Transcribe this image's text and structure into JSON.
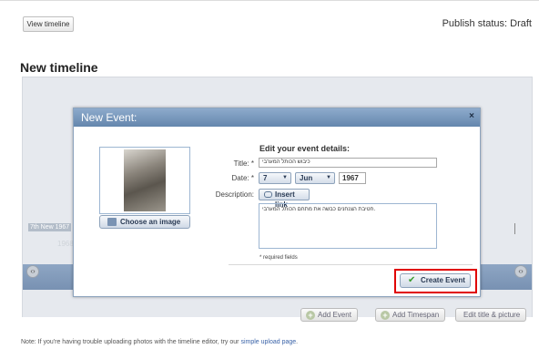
{
  "topbar": {
    "view_timeline": "View timeline",
    "publish_status": "Publish status: Draft"
  },
  "page_title": "New timeline",
  "stage": {
    "date_label": "7th New 1967",
    "year_label": "1968",
    "left_arrow": "‹›",
    "right_arrow": "‹›"
  },
  "modal": {
    "title": "New Event:",
    "close": "×",
    "choose_image": "Choose an image",
    "heading": "Edit your event details:",
    "title_label": "Title: *",
    "title_value": "כיבוש הכותל המערבי",
    "date_label": "Date: *",
    "day": "7",
    "month": "Jun",
    "year": "1967",
    "description_label": "Description:",
    "insert_link": "Insert link",
    "description_value": "חטיבת הצנחנים כבשה את מתחם הכותל המערבי.",
    "required_note": "* required fields",
    "create_event": "Create Event"
  },
  "bottom_buttons": {
    "add_event": "Add Event",
    "add_timespan": "Add Timespan",
    "edit_title": "Edit title & picture"
  },
  "note": {
    "text": "Note: If you're having trouble uploading photos with the timeline editor, try our",
    "link": "simple upload page",
    "end": "."
  },
  "colors": {
    "header": "#6f8db1",
    "highlight": "#e00000"
  }
}
